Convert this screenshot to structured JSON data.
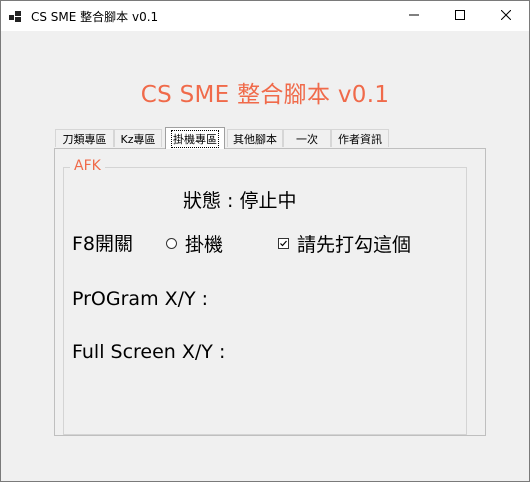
{
  "window": {
    "title": "CS SME 整合腳本 v0.1",
    "icon": "app-window-icon",
    "controls": [
      "minimize-icon",
      "maximize-icon",
      "close-icon"
    ]
  },
  "heading": "CS SME  整合腳本 v0.1",
  "accent_color": "#f06a4a",
  "tabs": [
    {
      "label": "刀類專區"
    },
    {
      "label": "Kz專區"
    },
    {
      "label": "掛機專區",
      "active": true
    },
    {
      "label": "其他腳本"
    },
    {
      "label": "一次"
    },
    {
      "label": "作者資訊"
    }
  ],
  "afk": {
    "group_title": "AFK",
    "status_label": "狀態 : 停止中",
    "hotkey_label": "F8開關",
    "radio_label": "掛機",
    "radio_checked": false,
    "checkbox_label": "請先打勾這個",
    "checkbox_checked": true,
    "program_xy_label": "PrOGram X/Y :",
    "fullscreen_xy_label": "Full Screen X/Y :"
  }
}
